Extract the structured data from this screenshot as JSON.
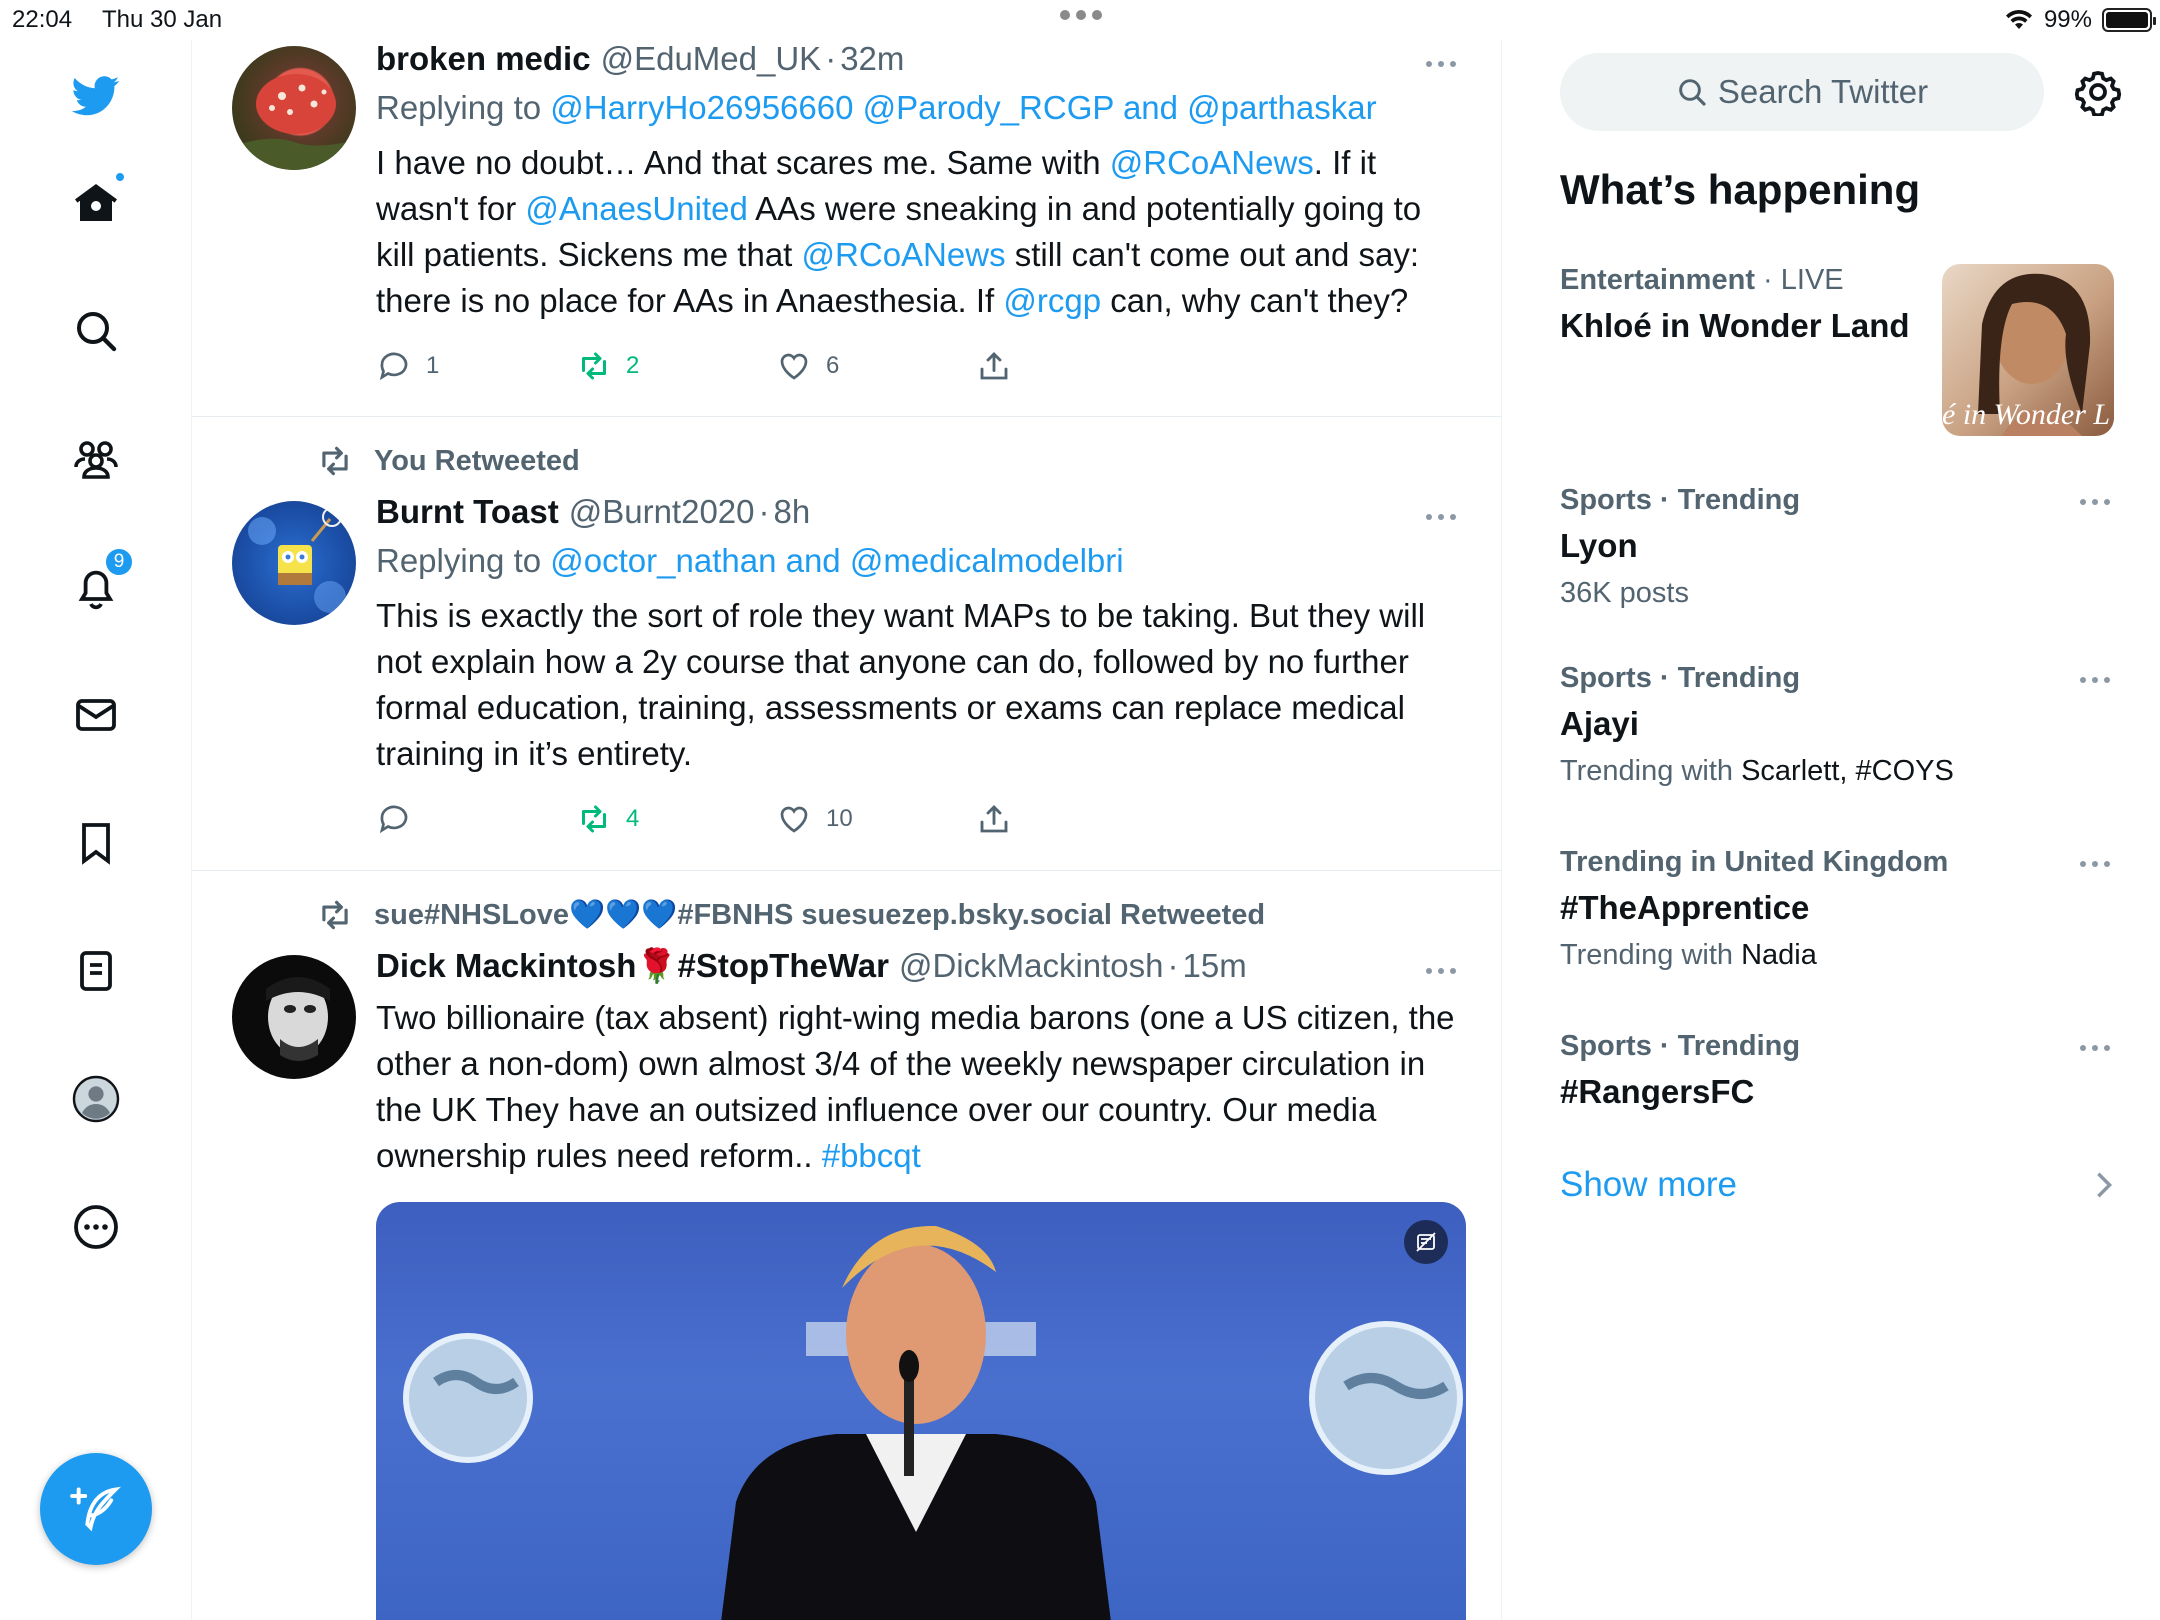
{
  "status": {
    "time": "22:04",
    "date": "Thu 30 Jan",
    "battery": "99%",
    "battery_level": 0.99
  },
  "nav": {
    "notifications_count": "9"
  },
  "search": {
    "placeholder": "Search Twitter"
  },
  "tweets": [
    {
      "name": "broken medic",
      "handle": "@EduMed_UK",
      "time": "32m",
      "replying_prefix": "Replying to",
      "replying_links": "@HarryHo26956660 @Parody_RCGP and @parthaskar",
      "text": {
        "t1": "I have no doubt… And that scares me. Same with ",
        "l1": "@RCoANews",
        "t2": ". If it wasn't for ",
        "l2": "@AnaesUnited",
        "t3": " AAs were sneaking in and potentially going to kill patients. Sickens me that ",
        "l3": "@RCoANews",
        "t4": " still can't come out and say: there is no place for AAs in Anaesthesia. If ",
        "l4": "@rcgp",
        "t5": " can, why can't they?"
      },
      "replies": "1",
      "retweets": "2",
      "likes": "6"
    },
    {
      "social": "You Retweeted",
      "name": "Burnt Toast",
      "handle": "@Burnt2020",
      "time": "8h",
      "replying_prefix": "Replying to",
      "replying_links": "@octor_nathan and @medicalmodelbri",
      "text": "This is exactly the sort of role they want MAPs to be taking. But they will not explain how a 2y course that anyone can do, followed by no further formal education, training, assessments or exams can replace medical training in it’s entirety.",
      "replies": "",
      "retweets": "4",
      "likes": "10"
    },
    {
      "social": "sue#NHSLove💙💙💙#FBNHS suesuezep.bsky.social Retweeted",
      "name": "Dick Mackintosh🌹#StopTheWar",
      "handle": "@DickMackintosh",
      "time": "15m",
      "text": {
        "t1": "Two billionaire (tax absent) right-wing media barons (one a US citizen, the other a non-dom) own almost 3/4 of the weekly newspaper circulation in the UK They have an outsized influence over our country. Our media ownership rules need reform.. ",
        "l1": "#bbcqt"
      }
    }
  ],
  "sidebar": {
    "title": "What’s happening",
    "trends": [
      {
        "category": "Entertainment",
        "meta_suffix": "LIVE",
        "name": "Khloé in Wonder Land",
        "image_caption": "é in Wonder L"
      },
      {
        "category": "Sports · Trending",
        "name": "Lyon",
        "sub": "36K posts"
      },
      {
        "category": "Sports · Trending",
        "name": "Ajayi",
        "sub_prefix": "Trending with",
        "sub_value": "Scarlett, #COYS"
      },
      {
        "category": "Trending in United Kingdom",
        "name": "#TheApprentice",
        "sub_prefix": "Trending with",
        "sub_value": "Nadia"
      },
      {
        "category": "Sports · Trending",
        "name": "#RangersFC"
      }
    ],
    "show_more": "Show more"
  },
  "colors": {
    "accent": "#1d9bf0",
    "retweet_green": "#00ba7c",
    "muted": "#536471"
  }
}
